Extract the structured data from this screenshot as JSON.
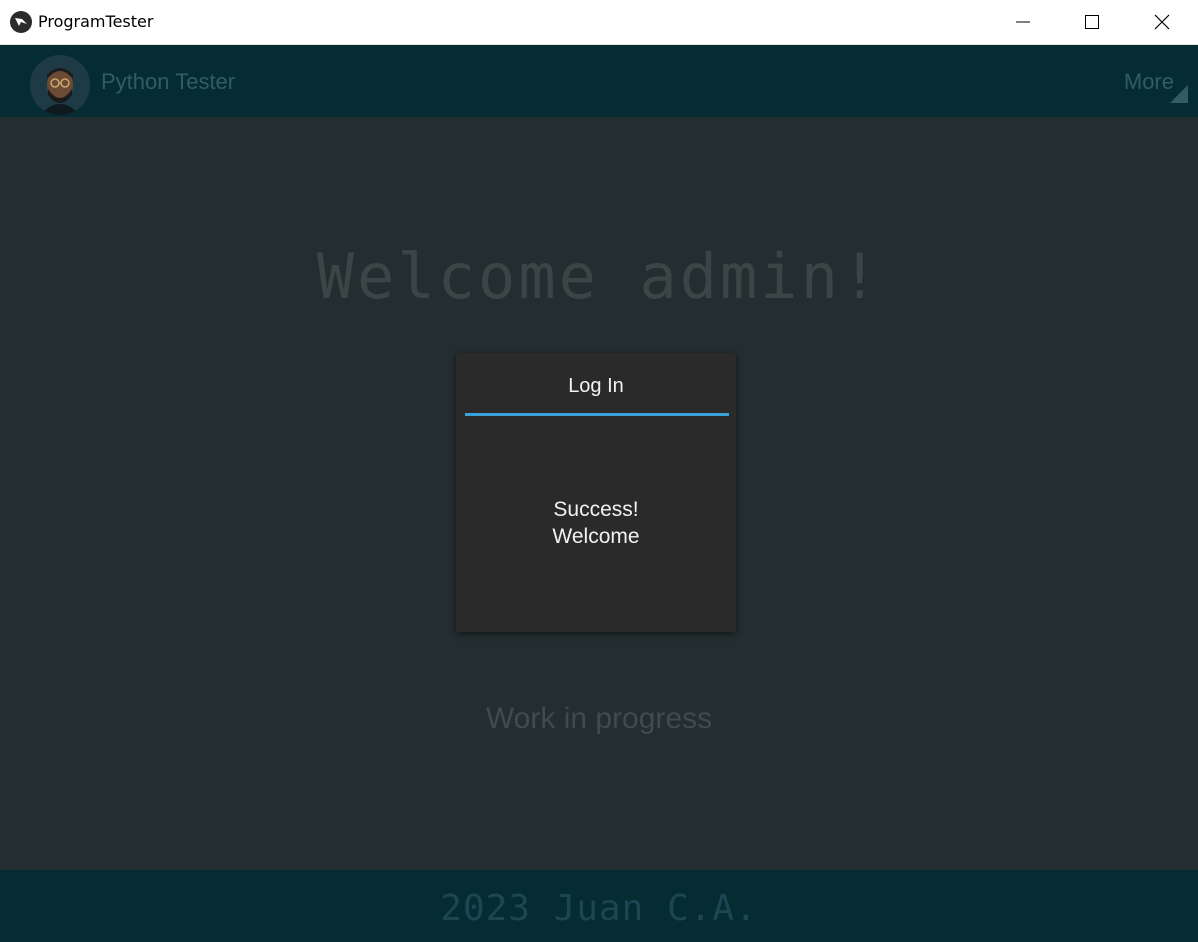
{
  "window": {
    "title": "ProgramTester",
    "logo_icon": "kivy-logo-icon",
    "controls": [
      "minimize-icon",
      "maximize-icon",
      "close-icon"
    ]
  },
  "appbar": {
    "avatar_icon": "user-avatar",
    "app_name": "Python Tester",
    "more_label": "More"
  },
  "main": {
    "welcome_text": "Welcome admin!",
    "status_text": "Work in progress"
  },
  "popup": {
    "title": "Log In",
    "message_line1": "Success!",
    "message_line2": "Welcome",
    "accent_color": "#3aa0d8"
  },
  "footer": {
    "text": "2023 Juan C.A."
  },
  "colors": {
    "appbar_bg": "#052b33",
    "main_bg": "#232e30",
    "popup_bg": "#2a2a2a"
  }
}
